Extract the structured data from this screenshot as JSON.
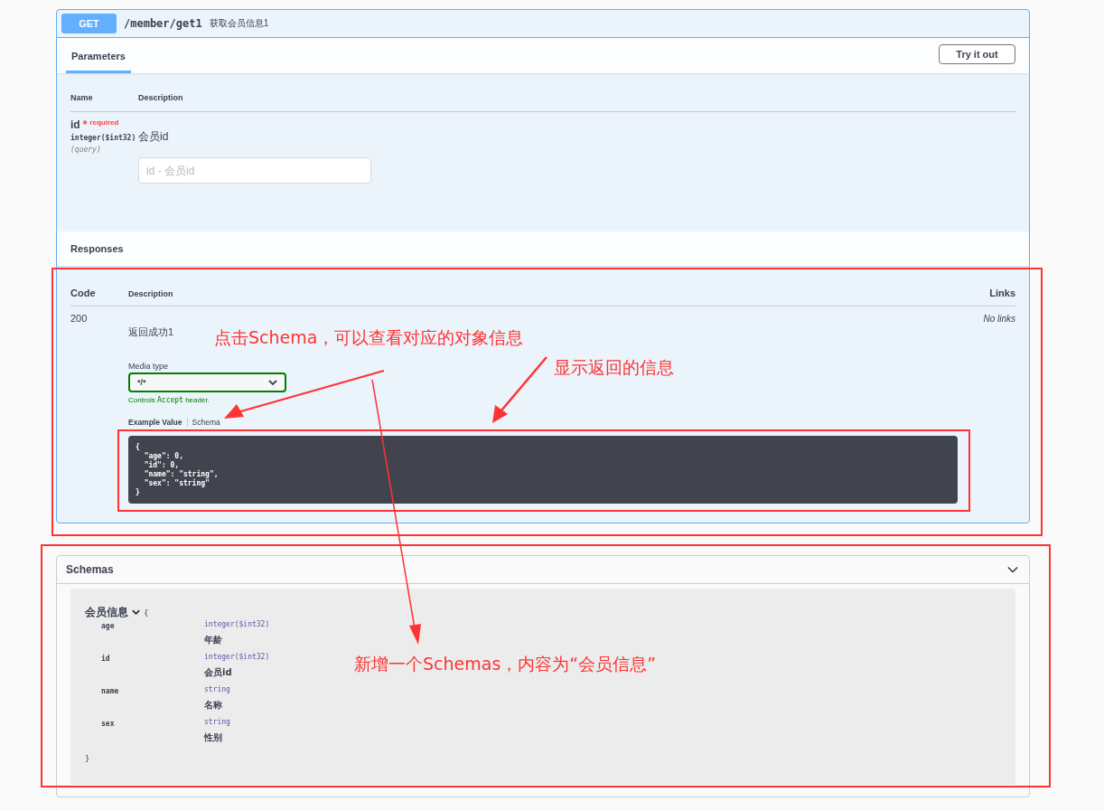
{
  "operation": {
    "method": "GET",
    "path": "/member/get1",
    "summary": "获取会员信息1"
  },
  "tabs": [
    {
      "label": "Parameters",
      "selected": true
    }
  ],
  "try_button": "Try it out",
  "parameters": {
    "columns": [
      "Name",
      "Description"
    ],
    "rows": [
      {
        "name": "id",
        "required_mark": "*",
        "required_label": "required",
        "type": "integer($int32)",
        "location": "(query)",
        "description": "会员id",
        "placeholder": "id - 会员id"
      }
    ]
  },
  "responses": {
    "title": "Responses",
    "columns": [
      "Code",
      "Description",
      "Links"
    ],
    "rows": [
      {
        "code": "200",
        "description": "返回成功1",
        "media_type_label": "Media type",
        "media_type": "*/*",
        "hint": [
          "Controls",
          "Accept",
          "header."
        ],
        "example_tabs": [
          {
            "label": "Example Value",
            "selected": true
          },
          {
            "label": "Schema",
            "selected": false
          }
        ],
        "example": [
          "{",
          "  \"age\": 0,",
          "  \"id\": 0,",
          "  \"name\": \"string\",",
          "  \"sex\": \"string\"",
          "}"
        ],
        "links": "No links"
      }
    ]
  },
  "schemas": {
    "title": "Schemas",
    "expanded": true,
    "model": {
      "name": "会员信息",
      "open": "{",
      "close": "}",
      "properties": [
        {
          "name": "age",
          "type": "integer($int32)",
          "description": "年龄"
        },
        {
          "name": "id",
          "type": "integer($int32)",
          "description": "会员id"
        },
        {
          "name": "name",
          "type": "string",
          "description": "名称"
        },
        {
          "name": "sex",
          "type": "string",
          "description": "性别"
        }
      ]
    }
  },
  "annotations": [
    {
      "text": "点击Schema，可以查看对应的对象信息"
    },
    {
      "text": "显示返回的信息"
    },
    {
      "text": "新增一个Schemas，内容为“会员信息”"
    }
  ]
}
